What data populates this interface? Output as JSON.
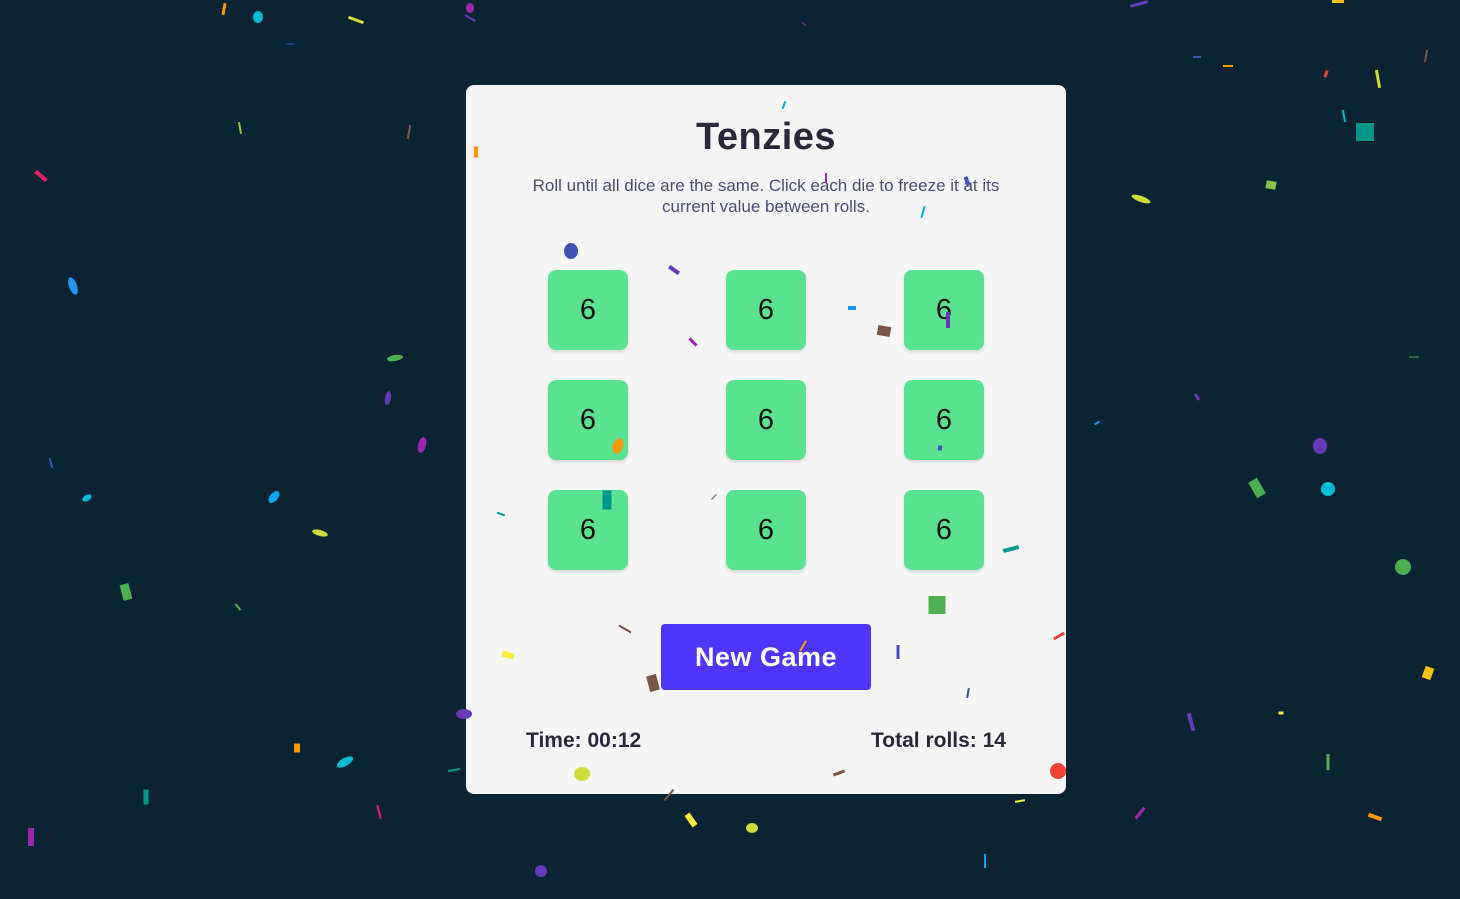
{
  "game": {
    "title": "Tenzies",
    "instructions": "Roll until all dice are the same. Click each die to freeze it at its current value between rolls.",
    "dice": [
      {
        "value": "6"
      },
      {
        "value": "6"
      },
      {
        "value": "6"
      },
      {
        "value": "6"
      },
      {
        "value": "6"
      },
      {
        "value": "6"
      },
      {
        "value": "6"
      },
      {
        "value": "6"
      },
      {
        "value": "6"
      }
    ],
    "new_game_label": "New Game",
    "time_text": "Time: 00:12",
    "rolls_text": "Total rolls: 14"
  },
  "colors": {
    "background": "#0b2434",
    "card": "#f5f5f5",
    "die": "#59e391",
    "button": "#5035ff",
    "title": "#2b283a",
    "instructions": "#4a4e74"
  }
}
